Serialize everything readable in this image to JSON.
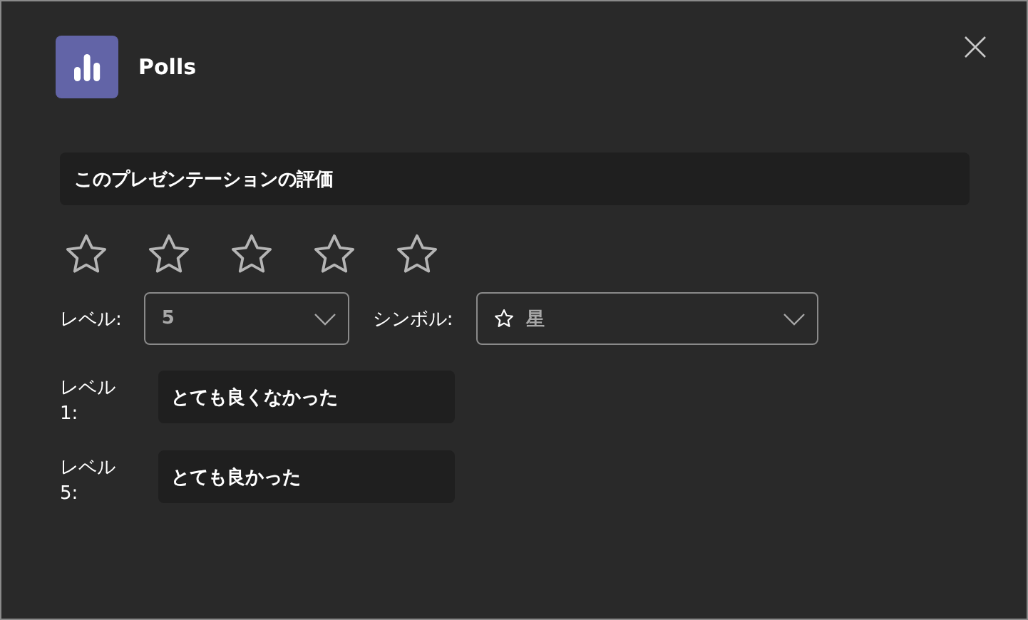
{
  "app": {
    "title": "Polls"
  },
  "question": {
    "value": "このプレゼンテーションの評価"
  },
  "rating": {
    "stars": 0
  },
  "dropdowns": [
    {
      "kind": "plain",
      "label": "レベル:",
      "value": "5"
    },
    {
      "kind": "symbol",
      "label": "シンボル:",
      "value": "星"
    }
  ],
  "level_labels": [
    {
      "label": "レベル 1:",
      "value": "とても良くなかった"
    },
    {
      "label": "レベル 5:",
      "value": "とても良かった"
    }
  ]
}
